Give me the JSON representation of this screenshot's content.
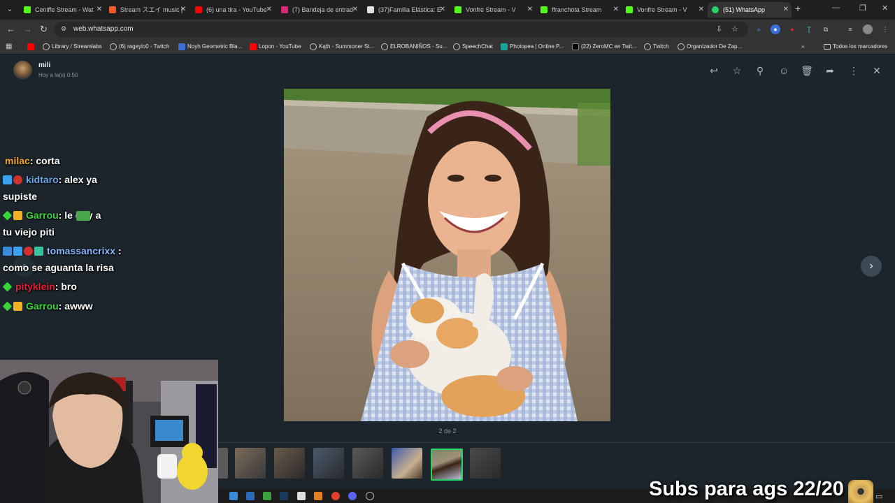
{
  "tabs": [
    {
      "title": "Ceniffe Stream - Wat",
      "color": "#53fc18"
    },
    {
      "title": "Stream スエイ music | ",
      "color": "#f05a28"
    },
    {
      "title": "(6) una tira - YouTube",
      "color": "#ff0000"
    },
    {
      "title": "(7) Bandeja de entrad",
      "color": "#d62976"
    },
    {
      "title": "(37)Familia Elástica: E",
      "color": "#e3e3e3"
    },
    {
      "title": "Vonfre Stream - V",
      "color": "#53fc18"
    },
    {
      "title": "ffranchota Stream",
      "color": "#53fc18"
    },
    {
      "title": "Vonfre Stream - V",
      "color": "#53fc18"
    },
    {
      "title": "(51) WhatsApp",
      "color": "#25d366"
    }
  ],
  "address": {
    "url": "web.whatsapp.com"
  },
  "bookmarks": [
    {
      "label": "",
      "color": "#ff0000"
    },
    {
      "label": "Library / Streamlabs",
      "color": "#c7c7c7"
    },
    {
      "label": "(6) rageylo0 - Twitch",
      "color": "#c7c7c7"
    },
    {
      "label": "Noyh Geometric Bla...",
      "color": "#3b6fd8"
    },
    {
      "label": "Lopon - YouTube",
      "color": "#ff0000"
    },
    {
      "label": "Kąth - Summoner St...",
      "color": "#c7c7c7"
    },
    {
      "label": "ELROBANIÑOS - Su...",
      "color": "#c7c7c7"
    },
    {
      "label": "SpeechChat",
      "color": "#c7c7c7"
    },
    {
      "label": "Photopea | Online P...",
      "color": "#18a497"
    },
    {
      "label": "(22) ZeroMC en Twit...",
      "color": "#e3e3e3"
    },
    {
      "label": "Twitch",
      "color": "#c7c7c7"
    },
    {
      "label": "Organizador De Zap...",
      "color": "#c7c7c7"
    }
  ],
  "all_bookmarks": "Todos los marcadores",
  "viewer": {
    "contact_name": "mili",
    "timestamp": "Hoy a la(s) 0:50",
    "counter": "2 de 2"
  },
  "chat": [
    {
      "user": "milac",
      "user_color": "#f0a830",
      "msg": ": corta"
    },
    {
      "user": "kidtaro",
      "user_color": "#6aa8f0",
      "msg": ": alex ya"
    },
    {
      "user": "",
      "user_color": "",
      "msg": "supiste"
    },
    {
      "user": "Garrou",
      "user_color": "#3ad43a",
      "msg": ":       le doy a"
    },
    {
      "user": "",
      "user_color": "",
      "msg": "tu viejo piti"
    },
    {
      "user": "tomassancrixx",
      "user_color": "#8ab8ff",
      "msg": " :"
    },
    {
      "user": "",
      "user_color": "",
      "msg": "como se aguanta la risa"
    },
    {
      "user": "pityklein",
      "user_color": "#e0203a",
      "msg": ": bro"
    },
    {
      "user": "Garrou",
      "user_color": "#3ad43a",
      "msg": ": awww"
    }
  ],
  "overlay": {
    "subs_goal": "Subs para ags 22/20"
  }
}
